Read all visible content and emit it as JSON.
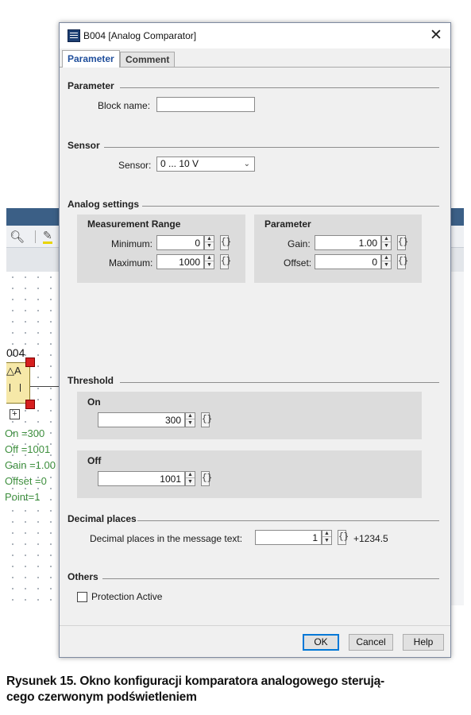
{
  "background_editor": {
    "block_label": "004",
    "block_symbol": "△A",
    "add_icon_glyph": "+",
    "params": [
      "On  =300",
      "Off  =1001",
      "Gain  =1.00",
      "Offset =0",
      "Point=1"
    ]
  },
  "dialog": {
    "title": "B004 [Analog Comparator]",
    "close_glyph": "✕",
    "tabs": [
      {
        "label": "Parameter",
        "active": true
      },
      {
        "label": "Comment",
        "active": false
      }
    ],
    "parameter_section": {
      "heading": "Parameter",
      "block_name_label": "Block name:",
      "block_name_value": ""
    },
    "sensor_section": {
      "heading": "Sensor",
      "sensor_label": "Sensor:",
      "sensor_value": "0 ... 10 V"
    },
    "analog_settings": {
      "heading": "Analog settings",
      "measurement_range": {
        "title": "Measurement Range",
        "minimum_label": "Minimum:",
        "minimum_value": "0",
        "maximum_label": "Maximum:",
        "maximum_value": "1000"
      },
      "parameter": {
        "title": "Parameter",
        "gain_label": "Gain:",
        "gain_value": "1.00",
        "offset_label": "Offset:",
        "offset_value": "0"
      }
    },
    "threshold": {
      "heading": "Threshold",
      "on_title": "On",
      "on_value": "300",
      "off_title": "Off",
      "off_value": "1001"
    },
    "decimal_places": {
      "heading": "Decimal places",
      "label": "Decimal places in the message text:",
      "value": "1",
      "preview": "+1234.5"
    },
    "others": {
      "heading": "Others",
      "protection_label": "Protection Active",
      "protection_checked": false
    },
    "buttons": {
      "ok": "OK",
      "cancel": "Cancel",
      "help": "Help"
    },
    "spin_up_glyph": "▲",
    "spin_down_glyph": "▼",
    "brace_glyph": "{}",
    "chevron_glyph": "⌄"
  },
  "caption": "Rysunek 15. Okno konfiguracji komparatora analogowego sterują-cego czerwonym podświetleniem",
  "caption_lines": [
    "Rysunek 15. Okno konfiguracji komparatora analogowego sterują-",
    "cego czerwonym podświetleniem"
  ],
  "colors": {
    "dialog_bg": "#f0f0f0",
    "group_bg": "#dcdcdc",
    "active_tab_text": "#1f4e9b",
    "param_text_green": "#3e8f3e",
    "pin_red": "#d61f1f",
    "block_yellow": "#f6e8a8"
  }
}
